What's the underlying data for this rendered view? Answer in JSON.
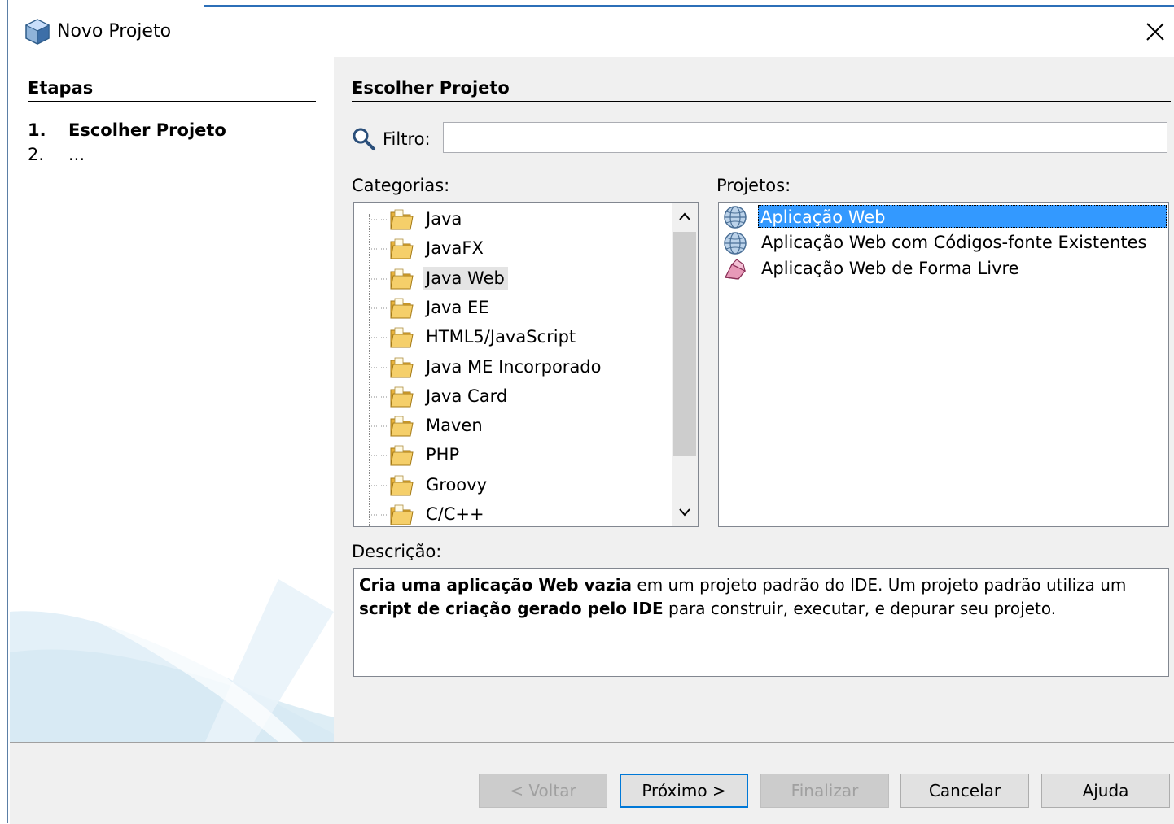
{
  "window": {
    "title": "Novo Projeto"
  },
  "steps": {
    "title": "Etapas",
    "items": [
      {
        "num": "1.",
        "label": "Escolher Projeto"
      },
      {
        "num": "2.",
        "label": "..."
      }
    ]
  },
  "panel": {
    "title": "Escolher Projeto",
    "filter_label": "Filtro:",
    "filter_value": "",
    "categories_label": "Categorias:",
    "projects_label": "Projetos:",
    "description_label": "Descrição:"
  },
  "categories": [
    "Java",
    "JavaFX",
    "Java Web",
    "Java EE",
    "HTML5/JavaScript",
    "Java ME Incorporado",
    "Java Card",
    "Maven",
    "PHP",
    "Groovy",
    "C/C++"
  ],
  "selected_category": "Java Web",
  "projects": [
    {
      "label": "Aplicação Web",
      "icon": "globe-icon"
    },
    {
      "label": "Aplicação Web com Códigos-fonte Existentes",
      "icon": "globe-icon"
    },
    {
      "label": "Aplicação Web de Forma Livre",
      "icon": "free-form-icon"
    }
  ],
  "selected_project": "Aplicação Web",
  "description": {
    "p1_bold": "Cria uma aplicação Web vazia",
    "p1_text": " em um projeto padrão do IDE. Um projeto padrão utiliza um ",
    "p2_bold": "script de criação gerado pelo IDE",
    "p2_text": " para construir, executar, e depurar seu projeto."
  },
  "buttons": {
    "back": "< Voltar",
    "next": "Próximo >",
    "finish": "Finalizar",
    "cancel": "Cancelar",
    "help": "Ajuda"
  },
  "colors": {
    "selection": "#3399ff",
    "accent": "#0078d7",
    "folder": "#e8b33c"
  }
}
